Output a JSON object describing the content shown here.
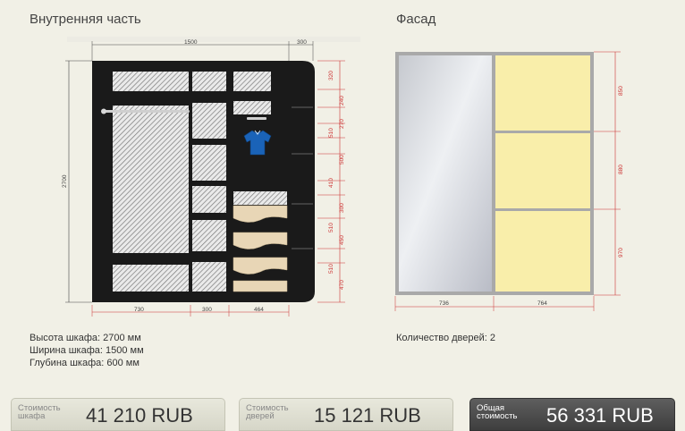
{
  "interior": {
    "title": "Внутренняя часть"
  },
  "facade": {
    "title": "Фасад"
  },
  "dimensions": {
    "top_width": "1500",
    "top_side": "300",
    "height": "2700",
    "bottom": [
      "730",
      "300",
      "464"
    ],
    "right": [
      "320",
      "240",
      "270",
      "510",
      "500",
      "410",
      "300",
      "510",
      "450",
      "510",
      "470"
    ],
    "facade_bottom": [
      "736",
      "764"
    ],
    "facade_right": [
      "850",
      "880",
      "970"
    ]
  },
  "specs": {
    "height": "Высота шкафа: 2700 мм",
    "width": "Ширина шкафа: 1500 мм",
    "depth": "Глубина шкафа: 600 мм",
    "doors": "Количество дверей: 2"
  },
  "prices": {
    "cabinet": {
      "label": "Стоимость шкафа",
      "value": "41 210  RUB"
    },
    "doors": {
      "label": "Стоимость дверей",
      "value": "15 121  RUB"
    },
    "total": {
      "label": "Общая стоимость",
      "value": "56 331  RUB"
    }
  },
  "colors": {
    "frame": "#1a1a1a",
    "panel": "#f9eeaa",
    "mirror": "#c9cdd4",
    "dim_line": "#c33333"
  }
}
